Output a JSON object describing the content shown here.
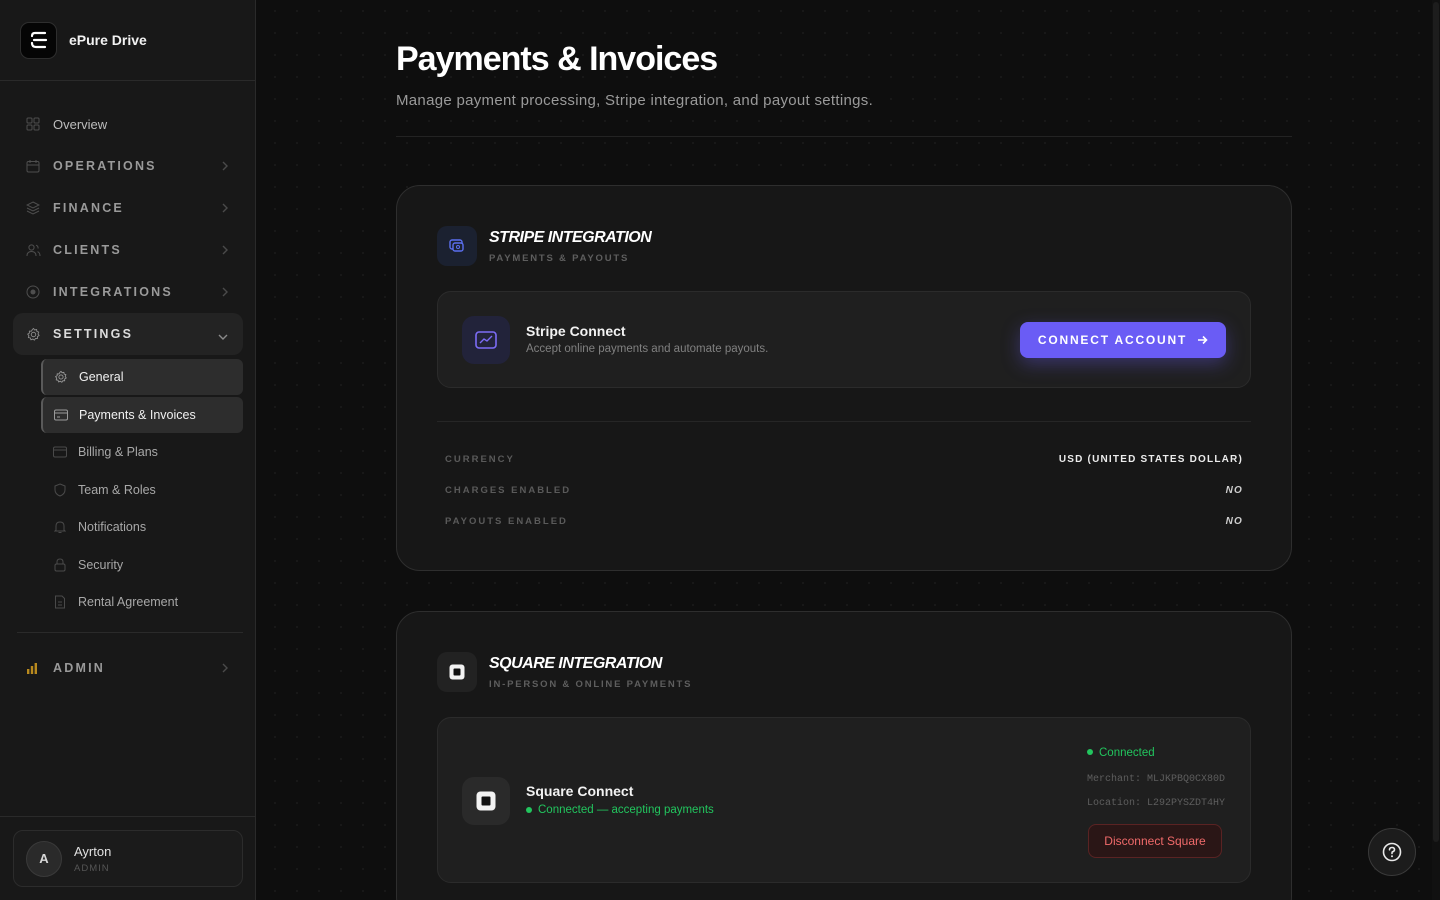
{
  "app": {
    "name": "ÉPure Drive",
    "brand_name": "ePure Drive"
  },
  "sidebar": {
    "items": [
      {
        "label": "Overview"
      },
      {
        "label": "OPERATIONS"
      },
      {
        "label": "FINANCE"
      },
      {
        "label": "CLIENTS"
      },
      {
        "label": "INTEGRATIONS"
      },
      {
        "label": "SETTINGS"
      }
    ],
    "settings_sub": [
      {
        "label": "General"
      },
      {
        "label": "Payments & Invoices"
      },
      {
        "label": "Billing & Plans"
      },
      {
        "label": "Team & Roles"
      },
      {
        "label": "Notifications"
      },
      {
        "label": "Security"
      },
      {
        "label": "Rental Agreement"
      }
    ],
    "admin": {
      "label": "ADMIN"
    },
    "user": {
      "initial": "A",
      "name": "Ayrton",
      "role": "ADMIN"
    }
  },
  "page": {
    "title": "Payments & Invoices",
    "subtitle": "Manage payment processing, Stripe integration, and payout settings."
  },
  "stripe": {
    "title": "STRIPE INTEGRATION",
    "subtitle": "PAYMENTS & PAYOUTS",
    "connect_title": "Stripe Connect",
    "connect_desc": "Accept online payments and automate payouts.",
    "connect_button": "CONNECT ACCOUNT",
    "details": [
      {
        "label": "CURRENCY",
        "value": "USD (UNITED STATES DOLLAR)"
      },
      {
        "label": "CHARGES ENABLED",
        "value": "NO"
      },
      {
        "label": "PAYOUTS ENABLED",
        "value": "NO"
      }
    ]
  },
  "square": {
    "title": "SQUARE INTEGRATION",
    "subtitle": "IN-PERSON & ONLINE PAYMENTS",
    "connect_title": "Square Connect",
    "connect_status": "Connected — accepting payments",
    "status_badge": "Connected",
    "merchant": "Merchant: MLJKPBQ0CX80D",
    "location": "Location: L292PYSZDT4HY",
    "disconnect_button": "Disconnect Square"
  },
  "colors": {
    "accent": "#6a5cf5",
    "success": "#22c55e",
    "danger": "#f06a6a"
  }
}
